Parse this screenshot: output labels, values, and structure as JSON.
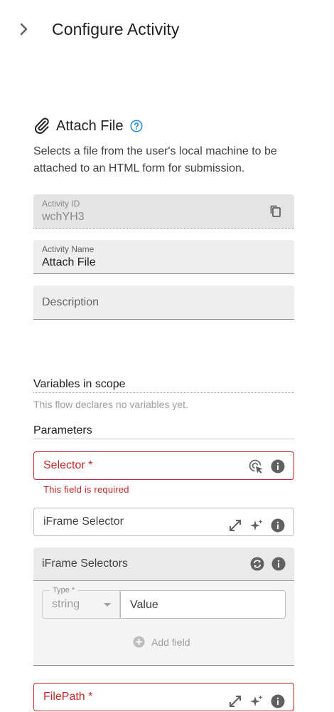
{
  "header": {
    "title": "Configure Activity"
  },
  "activity": {
    "title": "Attach File",
    "description": "Selects a file from the user's local machine to be attached to an HTML form for submission."
  },
  "fields": {
    "activity_id": {
      "label": "Activity ID",
      "value": "wchYH3"
    },
    "activity_name": {
      "label": "Activity Name",
      "value": "Attach File"
    },
    "description": {
      "placeholder": "Description"
    }
  },
  "variables": {
    "title": "Variables in scope",
    "empty_note": "This flow declares no variables yet."
  },
  "parameters": {
    "title": "Parameters",
    "selector": {
      "label": "Selector *",
      "error": "This field is required"
    },
    "iframe_selector": {
      "label": "iFrame Selector"
    },
    "iframe_selectors": {
      "title": "iFrame Selectors",
      "type_label": "Type *",
      "type_value": "string",
      "value_placeholder": "Value",
      "add_field": "Add field"
    },
    "filepath": {
      "label": "FilePath *"
    }
  },
  "colors": {
    "error": "#c62828",
    "accent": "#1e88e5",
    "icon": "#616161"
  }
}
